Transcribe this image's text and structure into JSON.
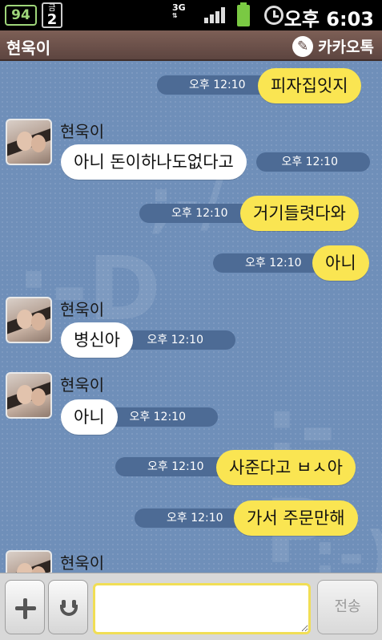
{
  "status_bar": {
    "battery_percent": "94",
    "sim_top": "금",
    "sim_bottom": "2",
    "network_type": "3G",
    "network_arrows": "⇅",
    "time": "오후 6:03"
  },
  "header": {
    "title": "현욱이",
    "brand": "카카오톡",
    "brand_icon": "talk-icon"
  },
  "messages": [
    {
      "dir": "out",
      "text": "피자집잇지",
      "time": "오후 12:10"
    },
    {
      "dir": "in",
      "sender": "현욱이",
      "text": "아니 돈이하나도없다고",
      "time": "오후 12:10"
    },
    {
      "dir": "out",
      "text": "거기들렷다와",
      "time": "오후 12:10"
    },
    {
      "dir": "out",
      "text": "아니",
      "time": "오후 12:10"
    },
    {
      "dir": "in",
      "sender": "현욱이",
      "text": "병신아",
      "time": "오후 12:10"
    },
    {
      "dir": "in",
      "sender": "현욱이",
      "text": "아니",
      "time": "오후 12:10"
    },
    {
      "dir": "out",
      "text": "사준다고 ㅂㅅ아",
      "time": "오후 12:10"
    },
    {
      "dir": "out",
      "text": "가서 주문만해",
      "time": "오후 12:10"
    },
    {
      "dir": "in",
      "sender": "현욱이",
      "text": "",
      "time": ""
    }
  ],
  "watermarks": [
    ";-/",
    ":-D",
    ";-P",
    ":-)"
  ],
  "input_bar": {
    "message_value": "",
    "send_label": "전송"
  },
  "colors": {
    "chat_bg": "#6f8fb9",
    "outgoing_bubble": "#fae552",
    "incoming_bubble": "#ffffff",
    "header_bg": "#6e534c",
    "time_pill": "#4d6b95"
  }
}
